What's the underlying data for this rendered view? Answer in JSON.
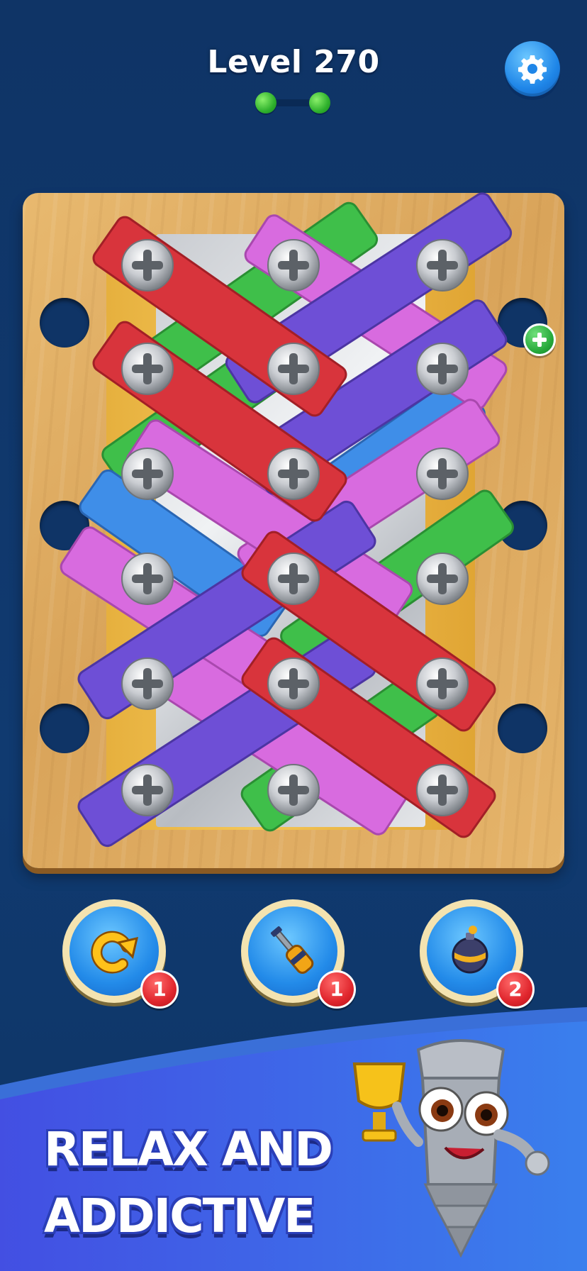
{
  "header": {
    "level_label": "Level 270",
    "settings_icon": "gear-icon",
    "progress_stages_completed": 2,
    "progress_stages_total": 2
  },
  "board": {
    "screw_icon": "phillips-screw-icon",
    "add_hole_icon": "plus-icon",
    "colors": {
      "red": "#d8343c",
      "purple": "#6e4fd6",
      "pink": "#d86bdf",
      "green": "#3fbf4a",
      "blue": "#3f8ee8"
    }
  },
  "boosters": [
    {
      "name": "undo",
      "icon": "undo-arrow-icon",
      "count": "1"
    },
    {
      "name": "screwdriver",
      "icon": "screwdriver-icon",
      "count": "1"
    },
    {
      "name": "bomb",
      "icon": "bomb-icon",
      "count": "2"
    }
  ],
  "banner": {
    "line1": "RELAX AND",
    "line2": "ADDICTIVE",
    "mascot": "screw-mascot-with-trophy"
  }
}
